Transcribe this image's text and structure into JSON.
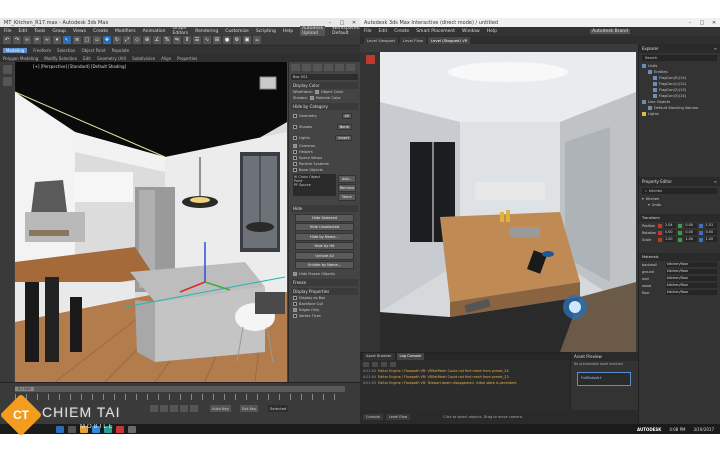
{
  "max": {
    "title": "MT_Kitchen_R17.max - Autodesk 3ds Max",
    "menus": [
      "File",
      "Edit",
      "Tools",
      "Group",
      "Views",
      "Create",
      "Modifiers",
      "Animation",
      "Graph Editors",
      "Rendering",
      "Customize",
      "Scripting",
      "Help"
    ],
    "user": "Autodesk Upload",
    "workspace": "Workspaces: Default",
    "ribbon_tabs": [
      "Modeling",
      "Freeform",
      "Selection",
      "Object Paint",
      "Populate"
    ],
    "ribbon_sub": [
      "Polygon Modeling",
      "Modify Selection",
      "Edit",
      "Geometry (All)",
      "Subdivision",
      "Align",
      "Properties"
    ],
    "viewport_label": "[+] [Perspective] [Standard] [Default Shading]",
    "cmd": {
      "dropdown": "Box 001",
      "sections": {
        "display_color": "Display Color",
        "wireframe": "Wireframe:",
        "shaded": "Shaded:",
        "object_color": "Object Color",
        "material_color": "Material Color",
        "hide_by_category": "Hide by Category",
        "hide": "Hide",
        "freeze": "Freeze",
        "display_props": "Display Properties"
      },
      "categories": [
        "Geometry",
        "Shapes",
        "Lights",
        "Cameras",
        "Helpers",
        "Space Warps",
        "Particle Systems",
        "Bone Objects"
      ],
      "cat_buttons": [
        "All",
        "None",
        "Invert"
      ],
      "list_items": [
        "IK Chain Object",
        "Point",
        "PF Source"
      ],
      "list_buttons": [
        "Add...",
        "Remove",
        "None"
      ],
      "hide_buttons": [
        "Hide Selected",
        "Hide Unselected",
        "Hide by Name...",
        "Hide by Hit",
        "Unhide All",
        "Unhide by Name...",
        "Hide Frozen Objects"
      ],
      "display_options": [
        "Display as Box",
        "Backface Cull",
        "Edges Only",
        "Vertex Ticks"
      ]
    },
    "timeline": {
      "frame": "0 / 100",
      "auto": "Auto Key",
      "set_key": "Set Key",
      "selected": "Selected"
    }
  },
  "inter": {
    "title": "Autodesk 3ds Max Interactive (direct mode) / untitled",
    "menus": [
      "File",
      "Edit",
      "Create",
      "Smart Placement",
      "Window",
      "Help"
    ],
    "user": "Autodesk Brand",
    "tabs": [
      "Level Viewport",
      "Level Flow",
      "Level (Stopped) VR"
    ],
    "explorer": {
      "title": "Explorer",
      "search": "Search",
      "rows": [
        "Units",
        "Entities",
        "FlagCon(0)(14)",
        "FlagCon(1)(12)",
        "FlagCon(2)(13)",
        "FlagCon(3)(14)",
        "Line Objects",
        "Default Stacking Volume",
        "Lights"
      ]
    },
    "property": {
      "title": "Property Editor",
      "search": "kitchen",
      "sections": [
        "Kitchen",
        "Units",
        "Transform"
      ],
      "rows": [
        {
          "label": "Position",
          "values": [
            "2.04",
            "0.00",
            "1.01"
          ]
        },
        {
          "label": "Rotation",
          "values": [
            "0.00",
            "0.00",
            "0.00"
          ]
        },
        {
          "label": "Scale",
          "values": [
            "1.00",
            "1.00",
            "1.00"
          ]
        }
      ],
      "material_title": "Materials",
      "materials": [
        "backwall",
        "ground",
        "wall",
        "wood",
        "floor"
      ],
      "material_values": [
        "kitchen/floor",
        "kitchen/floor",
        "kitchen/floor",
        "kitchen/floor",
        "kitchen/floor"
      ]
    },
    "log": {
      "tabs": [
        "Asset Browser",
        "Log Console"
      ],
      "lines": [
        {
          "time": "4:01:04",
          "msg": "Editor Engine / Flowpath VR: VRSetMesh Could not find mesh from preset_24"
        },
        {
          "time": "4:01:04",
          "msg": "Editor Engine / Flowpath VR: VRSetMesh Could not find mesh from preset_23"
        },
        {
          "time": "4:01:05",
          "msg": "Editor Engine / Flowpath VR: Teleport beam disappeared, initial state is persistent"
        }
      ]
    },
    "asset": {
      "title": "Asset Preview",
      "note": "No previewable asset selected",
      "item": "FullBakeArt"
    },
    "status": {
      "tabs": [
        "Console",
        "Level Flow"
      ],
      "hint": "Click to select objects. Drag to move camera."
    }
  },
  "taskbar": {
    "time": "4:08 PM",
    "date": "3/19/2017",
    "brand": "AUTODESK"
  },
  "watermark": {
    "badge": "CT",
    "name": "CHIEM TAI",
    "sub": "MOBILE"
  }
}
